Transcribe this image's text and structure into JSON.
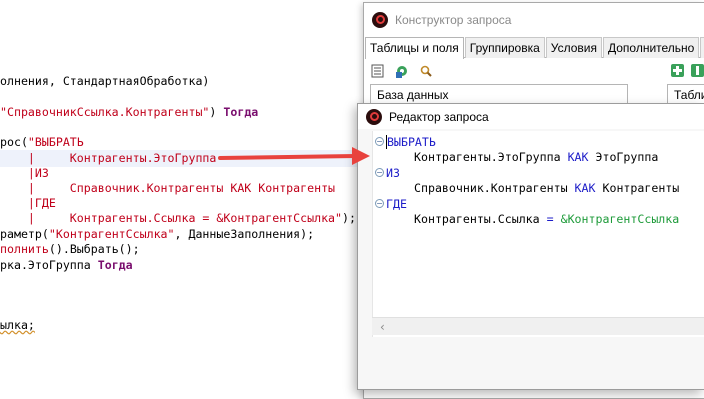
{
  "code": {
    "line1": "олнения, СтандартнаяОбработка)",
    "line2_str": "\"СправочникСсылка.Контрагенты\"",
    "line2_mid": ") ",
    "line2_kw": "Тогда",
    "line3_a": "рос(",
    "line3_q": "\"ВЫБРАТЬ",
    "line4": "    |     Контрагенты.ЭтоГруппа",
    "line5": "    |ИЗ",
    "line6": "    |     Справочник.Контрагенты КАК Контрагенты",
    "line7": "    |ГДЕ",
    "line8_q": "    |     Контрагенты.Ссылка = &КонтрагентСсылка\"",
    "line8_end": ");",
    "line9_a": "раметр(",
    "line9_str": "\"КонтрагентСсылка\"",
    "line9_b": ", ДанныеЗаполнения);",
    "line10_kw": "полнить",
    "line10_b": "().Выбрать();",
    "line11_a": "рка.ЭтоГруппа ",
    "line11_kw": "Тогда",
    "line12": "ылка;"
  },
  "query_builder": {
    "title": "Конструктор запроса",
    "tabs": [
      "Таблицы и поля",
      "Группировка",
      "Условия",
      "Дополнительно",
      "О"
    ],
    "database_header": "База данных",
    "tables_header": "Табли"
  },
  "query_editor": {
    "title": "Редактор запроса",
    "select_kw": "ВЫБРАТЬ",
    "field_a": "Контрагенты.ЭтоГруппа ",
    "field_kak": "КАК",
    "field_alias": " ЭтоГруппа",
    "from_kw": "ИЗ",
    "source_a": "Справочник.Контрагенты ",
    "source_kak": "КАК",
    "source_alias": " Контрагенты",
    "where_kw": "ГДЕ",
    "cond_a": "Контрагенты.Ссылка ",
    "cond_eq": "=",
    "cond_param": " &КонтрагентСсылка"
  },
  "colors": {
    "arrow": "#e8423d",
    "keyword": "#7a0e6e",
    "string": "#c0001a",
    "query_keyword": "#1c1cc8",
    "parameter": "#1e9b3a"
  }
}
